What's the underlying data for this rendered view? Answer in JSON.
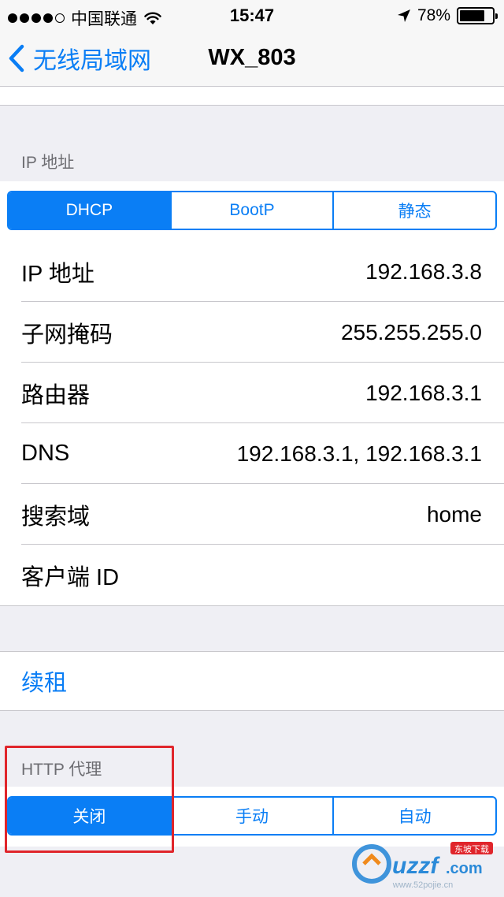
{
  "status_bar": {
    "carrier": "中国联通",
    "time": "15:47",
    "battery": "78%",
    "battery_level": 0.78
  },
  "nav": {
    "back_label": "无线局域网",
    "title": "WX_803"
  },
  "ip_section": {
    "header": "IP 地址",
    "segments": [
      "DHCP",
      "BootP",
      "静态"
    ],
    "selected": "DHCP"
  },
  "rows": [
    {
      "label": "IP 地址",
      "value": "192.168.3.8"
    },
    {
      "label": "子网掩码",
      "value": "255.255.255.0"
    },
    {
      "label": "路由器",
      "value": "192.168.3.1"
    },
    {
      "label": "DNS",
      "value": "192.168.3.1, 192.168.3.1"
    },
    {
      "label": "搜索域",
      "value": "home"
    },
    {
      "label": "客户端 ID",
      "value": ""
    }
  ],
  "renew_label": "续租",
  "proxy_section": {
    "header": "HTTP 代理",
    "segments": [
      "关闭",
      "手动",
      "自动"
    ],
    "selected": "关闭"
  },
  "colors": {
    "accent": "#0a7ef5",
    "highlight": "#e0252b",
    "background": "#efeff4"
  }
}
